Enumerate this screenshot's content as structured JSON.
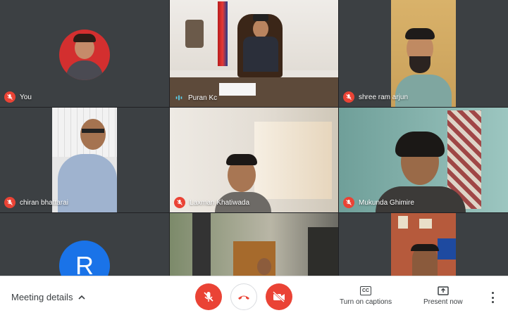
{
  "participants": [
    {
      "name": "You"
    },
    {
      "name": "Puran Kc"
    },
    {
      "name": "shree ram arjun"
    },
    {
      "name": "chiran bhattarai"
    },
    {
      "name": "Laxman Khatiwada"
    },
    {
      "name": "Mukunda Ghimire"
    },
    {
      "initial": "R"
    }
  ],
  "toolbar": {
    "meeting_details": "Meeting details",
    "captions_label": "Turn on captions",
    "captions_icon_text": "CC",
    "present_label": "Present now"
  },
  "colors": {
    "grid_bg": "#202124",
    "red": "#ea4335",
    "avatar_blue": "#1a73e8"
  },
  "icons": [
    "mic-off-icon",
    "speaking-icon",
    "chevron-up-icon",
    "hang-up-icon",
    "camera-off-icon",
    "captions-icon",
    "present-icon",
    "more-vert-icon"
  ]
}
